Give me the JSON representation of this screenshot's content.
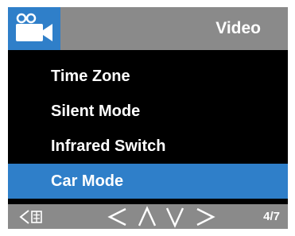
{
  "header": {
    "mode_icon": "video-camera-icon",
    "title": "Video"
  },
  "menu": {
    "items": [
      {
        "label": "Time Zone"
      },
      {
        "label": "SiIent Mode"
      },
      {
        "label": "Infrared Switch"
      },
      {
        "label": "Car Mode"
      }
    ],
    "selected_index": 3
  },
  "footer": {
    "icons": [
      "back-menu-icon",
      "left-arrow-icon",
      "up-arrow-icon",
      "down-arrow-icon",
      "right-arrow-icon"
    ],
    "page": "4/7"
  },
  "colors": {
    "accent": "#2f7fc9",
    "bar": "#8a8a8a",
    "background": "#000000",
    "text": "#ffffff"
  }
}
